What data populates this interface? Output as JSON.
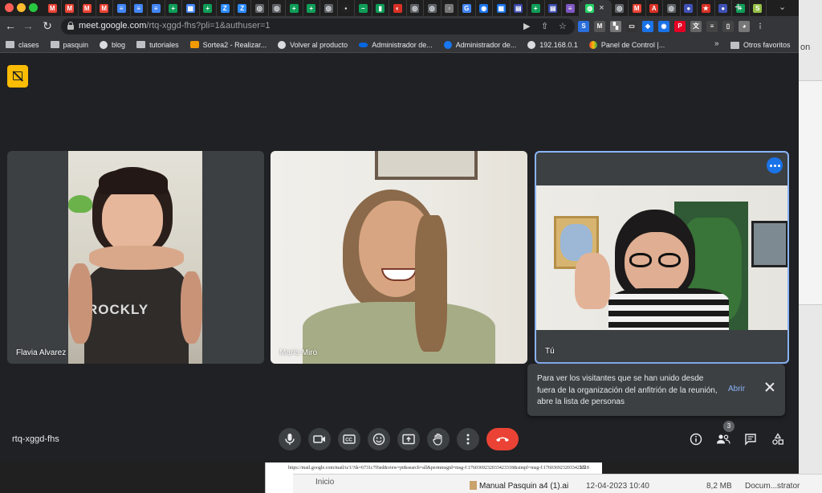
{
  "browser": {
    "url_host": "meet.google.com",
    "url_path": "/rtq-xggd-fhs?pli=1&authuser=1",
    "tab_favicons": [
      {
        "icon": "gmail-icon",
        "color": "#ea4335",
        "glyph": "M"
      },
      {
        "icon": "gmail-icon",
        "color": "#ea4335",
        "glyph": "M"
      },
      {
        "icon": "gmail-icon",
        "color": "#ea4335",
        "glyph": "M"
      },
      {
        "icon": "gmail-icon",
        "color": "#ea4335",
        "glyph": "M"
      },
      {
        "icon": "docs-icon",
        "color": "#4285f4",
        "glyph": "≡"
      },
      {
        "icon": "docs-icon",
        "color": "#4285f4",
        "glyph": "≡"
      },
      {
        "icon": "docs-icon",
        "color": "#4285f4",
        "glyph": "≡"
      },
      {
        "icon": "sheets-icon",
        "color": "#0f9d58",
        "glyph": "+"
      },
      {
        "icon": "calendar-icon",
        "color": "#4285f4",
        "glyph": "▦"
      },
      {
        "icon": "sheets-icon",
        "color": "#0f9d58",
        "glyph": "+"
      },
      {
        "icon": "zoom-icon",
        "color": "#2d8cff",
        "glyph": "Z"
      },
      {
        "icon": "zoom-icon",
        "color": "#2d8cff",
        "glyph": "Z"
      },
      {
        "icon": "chrome-icon",
        "color": "#5f6368",
        "glyph": "◎"
      },
      {
        "icon": "chrome-icon",
        "color": "#5f6368",
        "glyph": "◎"
      },
      {
        "icon": "sheets-icon",
        "color": "#0f9d58",
        "glyph": "+"
      },
      {
        "icon": "sheets-icon",
        "color": "#0f9d58",
        "glyph": "+"
      },
      {
        "icon": "chrome-icon",
        "color": "#5f6368",
        "glyph": "◎"
      },
      {
        "icon": "terminal-icon",
        "color": "#222222",
        "glyph": "▪"
      },
      {
        "icon": "dash-icon",
        "color": "#0f9d58",
        "glyph": "−"
      },
      {
        "icon": "analytics-icon",
        "color": "#0f9d58",
        "glyph": "▮"
      },
      {
        "icon": "red-icon",
        "color": "#d93025",
        "glyph": "◐"
      },
      {
        "icon": "chrome-icon",
        "color": "#5f6368",
        "glyph": "◎"
      },
      {
        "icon": "chrome-icon",
        "color": "#5f6368",
        "glyph": "◎"
      },
      {
        "icon": "page-icon",
        "color": "#777777",
        "glyph": "▫"
      },
      {
        "icon": "google-icon",
        "color": "#4285f4",
        "glyph": "G"
      },
      {
        "icon": "circle-icon",
        "color": "#1a73e8",
        "glyph": "◉"
      },
      {
        "icon": "calendar-icon",
        "color": "#1a73e8",
        "glyph": "▦"
      },
      {
        "icon": "news-icon",
        "color": "#3949ab",
        "glyph": "▤"
      },
      {
        "icon": "sheets-icon",
        "color": "#0f9d58",
        "glyph": "+"
      },
      {
        "icon": "news-icon",
        "color": "#3949ab",
        "glyph": "▤"
      },
      {
        "icon": "forms-icon",
        "color": "#7e57c2",
        "glyph": "≡"
      },
      {
        "icon": "whatsapp-icon",
        "color": "#25d366",
        "glyph": "◍"
      }
    ],
    "tab_favicons_after": [
      {
        "icon": "chrome-icon",
        "color": "#5f6368",
        "glyph": "◎"
      },
      {
        "icon": "gmail-icon",
        "color": "#ea4335",
        "glyph": "M"
      },
      {
        "icon": "acrobat-icon",
        "color": "#d93025",
        "glyph": "A"
      },
      {
        "icon": "chrome-icon",
        "color": "#5f6368",
        "glyph": "◎"
      },
      {
        "icon": "blue-dot-icon",
        "color": "#3f51b5",
        "glyph": "●"
      },
      {
        "icon": "star-icon",
        "color": "#d93025",
        "glyph": "★"
      },
      {
        "icon": "blue-dot-icon",
        "color": "#3f51b5",
        "glyph": "●"
      },
      {
        "icon": "sheets-icon",
        "color": "#0f9d58",
        "glyph": "+"
      },
      {
        "icon": "shopify-icon",
        "color": "#95bf47",
        "glyph": "S"
      }
    ],
    "new_tab": "+",
    "extensions": [
      {
        "icon": "s-icon",
        "color": "#2a6fdb",
        "glyph": "S"
      },
      {
        "icon": "gmail-icon",
        "color": "#555555",
        "glyph": "M"
      },
      {
        "icon": "puzzle-grey-icon",
        "color": "#777777",
        "glyph": "▚"
      },
      {
        "icon": "monitor-icon",
        "color": "#333333",
        "glyph": "▭"
      },
      {
        "icon": "tag-icon",
        "color": "#1a73e8",
        "glyph": "◆"
      },
      {
        "icon": "zoom-icon",
        "color": "#1a73e8",
        "glyph": "◉"
      },
      {
        "icon": "pinterest-icon",
        "color": "#e60023",
        "glyph": "P"
      },
      {
        "icon": "translate-icon",
        "color": "#666666",
        "glyph": "文"
      },
      {
        "icon": "playlist-icon",
        "color": "#444444",
        "glyph": "≡"
      },
      {
        "icon": "sidebar-icon",
        "color": "#444444",
        "glyph": "▯"
      },
      {
        "icon": "avatar-icon",
        "color": "#777777",
        "glyph": "◕"
      },
      {
        "icon": "kebab-icon",
        "color": "#35363a",
        "glyph": "⋮"
      }
    ],
    "bookmarks": [
      {
        "label": "clases",
        "icon": "folder"
      },
      {
        "label": "pasquin",
        "icon": "folder"
      },
      {
        "label": "blog",
        "icon": "globe"
      },
      {
        "label": "tutoriales",
        "icon": "folder"
      },
      {
        "label": "Sortea2 - Realizar...",
        "icon": "star"
      },
      {
        "label": "Volver al producto",
        "icon": "globe"
      },
      {
        "label": "Administrador de...",
        "icon": "meta"
      },
      {
        "label": "Administrador de...",
        "icon": "facebook"
      },
      {
        "label": "192.168.0.1",
        "icon": "globe"
      },
      {
        "label": "Panel de Control |...",
        "icon": "colors"
      }
    ],
    "bookmarks_more": "»",
    "other_bookmarks": "Otros favoritos"
  },
  "meet": {
    "meeting_code": "rtq-xggd-fhs",
    "participants": [
      {
        "name": "Flavia Alvarez"
      },
      {
        "name": "Maria Miro"
      },
      {
        "name": "Tú"
      }
    ],
    "notice": {
      "text": "Para ver los visitantes que se han unido desde fuera de la organización del anfitrión de la reunión, abre la lista de personas",
      "action": "Abrir"
    },
    "people_count": "3",
    "controls": [
      "microphone",
      "camera",
      "captions",
      "reactions",
      "present",
      "raise-hand",
      "more-options",
      "leave-call"
    ],
    "right_controls": [
      "meeting-details",
      "people",
      "chat",
      "activities"
    ],
    "hangup_color": "#ea4335",
    "accent_color": "#8ab4f8"
  },
  "background_windows": {
    "pdf_url": "https://mail.google.com/mail/u/1/?ik=6731c7f6ed&view=pt&search=all&permmsgid=msg-f:1760369232033423318&simpl=msg-f:1760369232033423318",
    "pdf_page": "1/2",
    "finder_inicio": "Inicio",
    "file_name": "Manual Pasquin a4 (1).ai",
    "file_date": "12-04-2023 10:40",
    "file_size": "8,2 MB",
    "file_kind": "Docum...strator",
    "right_window_text": "on"
  }
}
